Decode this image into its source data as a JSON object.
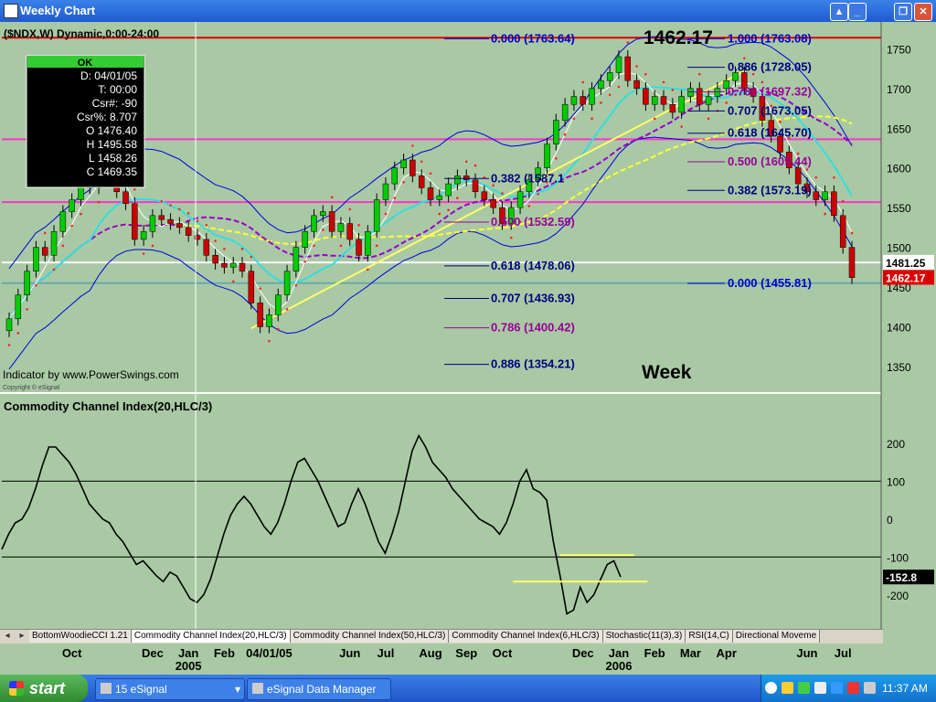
{
  "window": {
    "title": "Weekly Chart",
    "buttons": [
      "▲",
      "_",
      "❐",
      "✕"
    ]
  },
  "chart_header": "($NDX,W) Dynamic,0:00-24:00",
  "big_price": "1462.17",
  "week_label": "Week",
  "indicator_credit": "Indicator by www.PowerSwings.com",
  "copyright": "Copyright © eSignal",
  "cursor_box": {
    "ok": "OK",
    "lines": [
      "D: 04/01/05",
      "T: 00:00",
      "Csr#: -90",
      "Csr%: 8.707",
      "O 1476.40",
      "H 1495.58",
      "L 1458.26",
      "C 1469.35"
    ]
  },
  "colors": {
    "bg": "#a9c9a4",
    "candle_up": "#00cc00",
    "candle_down": "#cc0000",
    "fib_blue": "#0000cc",
    "fib_purple": "#990099",
    "fib_navy": "#000080",
    "trend": "#ffff66",
    "magenta_line": "#ff33cc",
    "red_line": "#dd0000"
  },
  "chart_data": [
    {
      "type": "candlestick",
      "symbol": "$NDX",
      "ylim": [
        1320,
        1770
      ],
      "yticks": [
        1350,
        1400,
        1450,
        1500,
        1550,
        1600,
        1650,
        1700,
        1750
      ],
      "x_labels": [
        {
          "t": "Oct",
          "w": 7
        },
        {
          "t": "Dec",
          "w": 16
        },
        {
          "t": "Jan",
          "w": 20
        },
        {
          "t": "Feb",
          "w": 24
        },
        {
          "t": "04/01/05",
          "w": 29
        },
        {
          "t": "Jun",
          "w": 38
        },
        {
          "t": "Jul",
          "w": 42
        },
        {
          "t": "Aug",
          "w": 47
        },
        {
          "t": "Sep",
          "w": 51
        },
        {
          "t": "Oct",
          "w": 55
        },
        {
          "t": "Dec",
          "w": 64
        },
        {
          "t": "Jan",
          "w": 68
        },
        {
          "t": "Feb",
          "w": 72
        },
        {
          "t": "Mar",
          "w": 76
        },
        {
          "t": "Apr",
          "w": 80
        },
        {
          "t": "Jun",
          "w": 89
        },
        {
          "t": "Jul",
          "w": 93
        }
      ],
      "year_labels": [
        {
          "t": "2005",
          "w": 20
        },
        {
          "t": "2006",
          "w": 68
        }
      ],
      "closes": [
        1410,
        1440,
        1470,
        1500,
        1490,
        1520,
        1545,
        1560,
        1580,
        1575,
        1600,
        1590,
        1570,
        1555,
        1510,
        1520,
        1540,
        1535,
        1530,
        1525,
        1515,
        1510,
        1490,
        1480,
        1475,
        1480,
        1470,
        1430,
        1400,
        1415,
        1440,
        1470,
        1500,
        1520,
        1540,
        1545,
        1520,
        1530,
        1510,
        1490,
        1520,
        1560,
        1580,
        1600,
        1610,
        1590,
        1575,
        1560,
        1565,
        1580,
        1590,
        1585,
        1570,
        1560,
        1550,
        1530,
        1550,
        1570,
        1585,
        1600,
        1630,
        1660,
        1680,
        1690,
        1680,
        1700,
        1710,
        1720,
        1740,
        1710,
        1700,
        1680,
        1690,
        1680,
        1670,
        1690,
        1700,
        1680,
        1690,
        1700,
        1710,
        1720,
        1700,
        1690,
        1660,
        1640,
        1620,
        1600,
        1580,
        1570,
        1560,
        1570,
        1540,
        1500,
        1462
      ],
      "value_labels": [
        {
          "label": "1481.25",
          "v": 1481.25,
          "color": "#ffffff",
          "text": "#000000"
        },
        {
          "label": "1462.17",
          "v": 1462.17,
          "color": "#dd0000",
          "text": "#ffffff"
        }
      ],
      "horizontal_lines": [
        {
          "v": 1764,
          "color": "#dd0000"
        },
        {
          "v": 1636,
          "color": "#ff33cc"
        },
        {
          "v": 1557,
          "color": "#ff33cc"
        },
        {
          "v": 1481,
          "color": "#ffffff"
        },
        {
          "v": 1455,
          "color": "#66aaaa"
        }
      ],
      "fib_left": [
        {
          "label": "0.000 (1763.64)",
          "v": 1765,
          "color": "#0000cc"
        },
        {
          "label": "0.382 (1587.1",
          "v": 1589,
          "color": "#000080"
        },
        {
          "label": "0.500 (1532.59)",
          "v": 1534,
          "color": "#990099"
        },
        {
          "label": "0.618 (1478.06)",
          "v": 1479,
          "color": "#000080"
        },
        {
          "label": "0.707 (1436.93)",
          "v": 1438,
          "color": "#000080"
        },
        {
          "label": "0.786 (1400.42)",
          "v": 1401,
          "color": "#990099"
        },
        {
          "label": "0.886 (1354.21)",
          "v": 1355,
          "color": "#000080"
        }
      ],
      "fib_right": [
        {
          "label": "1.000 (1763.08)",
          "v": 1765,
          "color": "#0000cc"
        },
        {
          "label": "0.886 (1728.05)",
          "v": 1729,
          "color": "#000080"
        },
        {
          "label": "0.786 (1697.32)",
          "v": 1698,
          "color": "#990099"
        },
        {
          "label": "0.707 (1673.05)",
          "v": 1674,
          "color": "#000080"
        },
        {
          "label": "0.618 (1645.70)",
          "v": 1646,
          "color": "#000080"
        },
        {
          "label": "0.500 (1609.44)",
          "v": 1610,
          "color": "#990099"
        },
        {
          "label": "0.382 (1573.19)",
          "v": 1574,
          "color": "#000080"
        },
        {
          "label": "0.000 (1455.81)",
          "v": 1457,
          "color": "#0000cc"
        }
      ]
    },
    {
      "type": "line",
      "title": "Commodity Channel Index(20,HLC/3)",
      "ylim": [
        -280,
        260
      ],
      "yticks": [
        200,
        100,
        0,
        -100,
        -200
      ],
      "gridlines": [
        100,
        -100
      ],
      "last_value": "-152.8",
      "values": [
        -80,
        -40,
        -10,
        0,
        30,
        80,
        140,
        190,
        190,
        170,
        150,
        120,
        80,
        40,
        20,
        0,
        -10,
        -40,
        -60,
        -90,
        -120,
        -110,
        -130,
        -150,
        -165,
        -140,
        -150,
        -180,
        -210,
        -220,
        -200,
        -160,
        -100,
        -40,
        10,
        40,
        60,
        40,
        10,
        -20,
        -40,
        -10,
        40,
        100,
        150,
        160,
        130,
        100,
        60,
        20,
        -20,
        -10,
        40,
        80,
        40,
        -10,
        -60,
        -90,
        -40,
        20,
        100,
        180,
        220,
        190,
        150,
        130,
        110,
        80,
        60,
        40,
        20,
        0,
        -10,
        -20,
        -40,
        -10,
        40,
        100,
        130,
        80,
        70,
        50,
        -60,
        -150,
        -250,
        -240,
        -180,
        -220,
        -200,
        -160,
        -120,
        -110,
        -152.8
      ],
      "markers": [
        {
          "v": -95,
          "from": 83,
          "to": 94
        },
        {
          "v": -165,
          "from": 76,
          "to": 96
        }
      ]
    }
  ],
  "tabs": [
    "BottomWoodieCCI 1.21",
    "Commodity Channel Index(20,HLC/3)",
    "Commodity Channel Index(50,HLC/3)",
    "Commodity Channel Index(6,HLC/3)",
    "Stochastic(11(3),3)",
    "RSI(14,C)",
    "Directional Moveme"
  ],
  "taskbar": {
    "start": "start",
    "items": [
      {
        "label": "15 eSignal"
      },
      {
        "label": "eSignal Data Manager"
      }
    ],
    "clock": "11:37 AM"
  }
}
